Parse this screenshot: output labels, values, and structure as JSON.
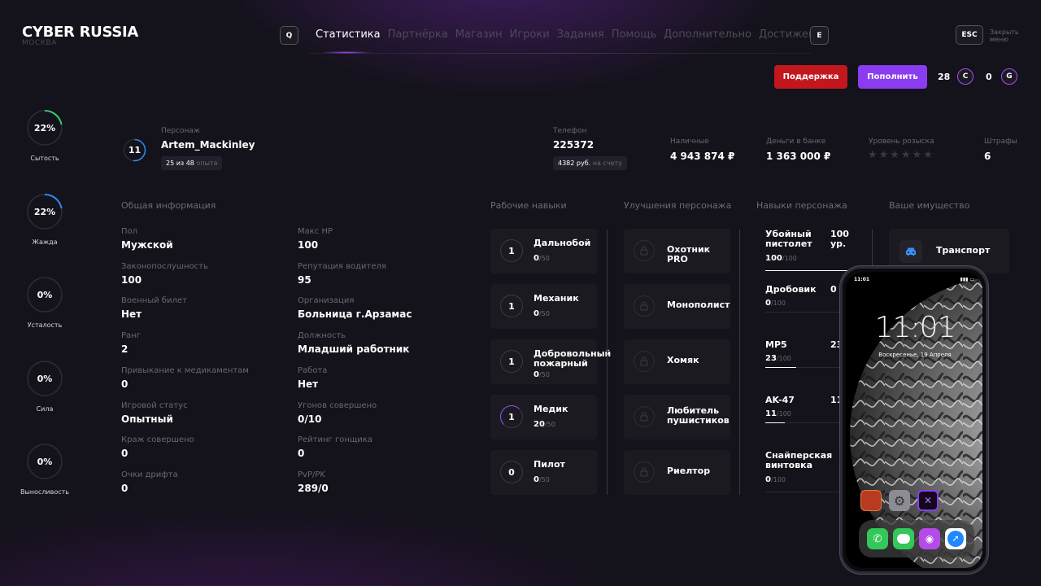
{
  "header": {
    "title": "CYBER RUSSIA",
    "subtitle": "МОСКВА",
    "key_left": "Q",
    "key_right": "E",
    "nav": [
      "Статистика",
      "Партнёрка",
      "Магазин",
      "Игроки",
      "Задания",
      "Помощь",
      "Дополнительно",
      "Достижения"
    ],
    "esc_label": "ESC",
    "close_menu": "Закрыть меню"
  },
  "actions": {
    "support": "Поддержка",
    "topup": "Пополнить",
    "c_amount": "28",
    "c_letter": "C",
    "g_amount": "0",
    "g_letter": "G"
  },
  "colors": {
    "accent": "#8a3df0",
    "danger": "#c3171e",
    "ring": "#2fd06e",
    "ring_blue": "#2a8cf0",
    "ring_purple": "#a64cff"
  },
  "needs": [
    {
      "value": "22%",
      "label": "Сытость",
      "fraction": 0.22,
      "color": "#2fd06e"
    },
    {
      "value": "22%",
      "label": "Жажда",
      "fraction": 0.22,
      "color": "#2a8cf0"
    },
    {
      "value": "0%",
      "label": "Усталость",
      "fraction": 0,
      "color": "#ffffff"
    },
    {
      "value": "0%",
      "label": "Сила",
      "fraction": 0,
      "color": "#ffffff"
    },
    {
      "value": "0%",
      "label": "Выносливость",
      "fraction": 0,
      "color": "#ffffff"
    }
  ],
  "character": {
    "level": "11",
    "label": "Персонаж",
    "name": "Artem_Mackinley",
    "exp_text": "25 из 48",
    "exp_suffix": "опыта",
    "phone_label": "Телефон",
    "phone": "225372",
    "account_text": "4382 руб.",
    "account_suffix": "на счету",
    "cash_label": "Наличные",
    "cash": "4 943 874 ₽",
    "bank_label": "Деньги в банке",
    "bank": "1 363 000 ₽",
    "wanted_label": "Уровень розыска",
    "wanted_stars": "★★★★★★",
    "fines_label": "Штрафы",
    "fines": "6"
  },
  "general": {
    "title": "Общая информация",
    "left": [
      {
        "label": "Пол",
        "value": "Мужской"
      },
      {
        "label": "Законопослушность",
        "value": "100"
      },
      {
        "label": "Военный билет",
        "value": "Нет"
      },
      {
        "label": "Ранг",
        "value": "2"
      },
      {
        "label": "Привыкание к медикаментам",
        "value": "0"
      },
      {
        "label": "Игровой статус",
        "value": "Опытный"
      },
      {
        "label": "Краж совершено",
        "value": "0"
      },
      {
        "label": "Очки дрифта",
        "value": "0"
      }
    ],
    "right": [
      {
        "label": "Макс HP",
        "value": "100"
      },
      {
        "label": "Репутация водителя",
        "value": "95"
      },
      {
        "label": "Организация",
        "value": "Больница г.Арзамас"
      },
      {
        "label": "Должность",
        "value": "Младший работник"
      },
      {
        "label": "Работа",
        "value": "Нет"
      },
      {
        "label": "Угонов совершено",
        "value": "0/10"
      },
      {
        "label": "Рейтинг гонщика",
        "value": "0"
      },
      {
        "label": "PvP/PK",
        "value": "289/0"
      }
    ]
  },
  "work_skills": {
    "title": "Рабочие навыки",
    "items": [
      {
        "level": "1",
        "name": "Дальнобой",
        "value": "0",
        "max": "/50"
      },
      {
        "level": "1",
        "name": "Механик",
        "value": "0",
        "max": "/50"
      },
      {
        "level": "1",
        "name": "Добровольный пожарный",
        "value": "0",
        "max": "/50"
      },
      {
        "level": "1",
        "name": "Медик",
        "value": "20",
        "max": "/50"
      },
      {
        "level": "0",
        "name": "Пилот",
        "value": "0",
        "max": "/50"
      }
    ]
  },
  "upgrades": {
    "title": "Улучшения персонажа",
    "items": [
      "Охотник PRO",
      "Монополист",
      "Хомяк",
      "Любитель пушистиков",
      "Риелтор"
    ]
  },
  "char_skills": {
    "title": "Навыки персонажа",
    "items": [
      {
        "name": "Убойный пистолет",
        "value": "100",
        "max": "/100",
        "right": "100 ур.",
        "fraction": 1.0
      },
      {
        "name": "Дробовик",
        "value": "0",
        "max": "/100",
        "right": "0",
        "fraction": 0
      },
      {
        "name": "MP5",
        "value": "23",
        "max": "/100",
        "right": "23",
        "fraction": 0.23
      },
      {
        "name": "AK-47",
        "value": "11",
        "max": "/100",
        "right": "11",
        "fraction": 0.11
      },
      {
        "name": "Снайперская винтовка",
        "value": "0",
        "max": "/100",
        "right": "",
        "fraction": 0
      }
    ]
  },
  "property": {
    "title": "Ваше имущество",
    "items": [
      {
        "name": "Транспорт",
        "icon": "car-icon"
      }
    ]
  },
  "phone": {
    "status_time": "11:01",
    "clock": "11:01",
    "date": "Воскресенье, 19 Апреля",
    "app_icons": [
      "samp-app-icon",
      "settings-app-icon",
      "game-app-icon"
    ],
    "dock_icons": [
      "phone-app-icon",
      "messages-app-icon",
      "podcasts-app-icon",
      "safari-app-icon"
    ]
  }
}
